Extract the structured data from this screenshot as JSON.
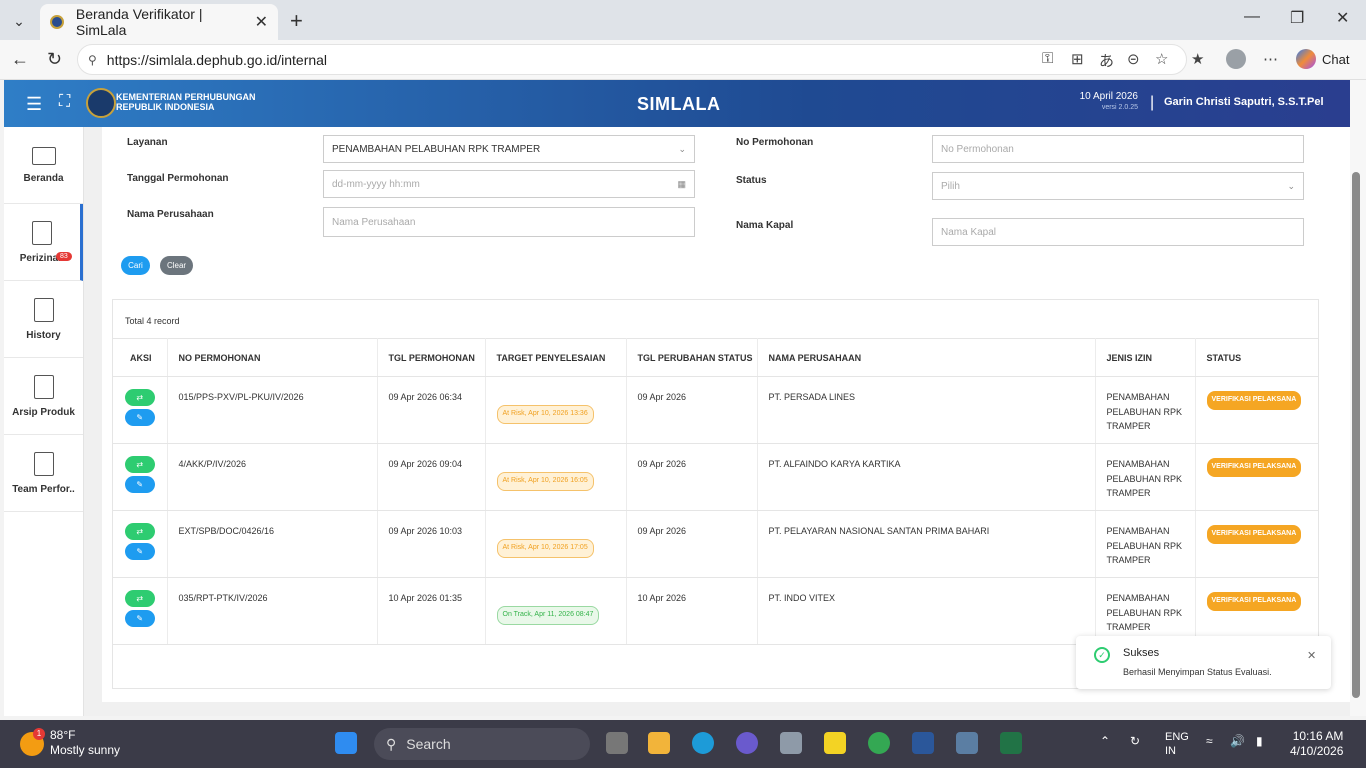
{
  "browser": {
    "tab_title": "Beranda Verifikator | SimLala",
    "url": "https://simlala.dephub.go.id/internal",
    "chat_label": "Chat"
  },
  "header": {
    "org_line1": "KEMENTERIAN PERHUBUNGAN",
    "org_line2": "REPUBLIK INDONESIA",
    "app_title": "SIMLALA",
    "date": "10 April 2026",
    "version": "versi 2.0.25",
    "user": "Garin Christi Saputri, S.S.T.Pel"
  },
  "sidebar": {
    "items": [
      {
        "label": "Beranda",
        "icon": "monitor-icon"
      },
      {
        "label": "Perizinan",
        "icon": "document-icon",
        "badge": "83"
      },
      {
        "label": "History",
        "icon": "document-icon"
      },
      {
        "label": "Arsip Produk",
        "icon": "document-icon"
      },
      {
        "label": "Team Perfor..",
        "icon": "document-icon"
      }
    ]
  },
  "filters": {
    "layanan_label": "Layanan",
    "layanan_value": "PENAMBAHAN PELABUHAN RPK TRAMPER",
    "tanggal_label": "Tanggal Permohonan",
    "tanggal_placeholder": "dd-mm-yyyy hh:mm",
    "nama_perusahaan_label": "Nama Perusahaan",
    "nama_perusahaan_placeholder": "Nama Perusahaan",
    "no_permohonan_label": "No Permohonan",
    "no_permohonan_placeholder": "No Permohonan",
    "status_label": "Status",
    "status_placeholder": "Pilih",
    "nama_kapal_label": "Nama Kapal",
    "nama_kapal_placeholder": "Nama Kapal",
    "cari_label": "Cari",
    "clear_label": "Clear"
  },
  "table": {
    "total": "Total 4 record",
    "headers": [
      "AKSI",
      "NO PERMOHONAN",
      "TGL PERMOHONAN",
      "TARGET PENYELESAIAN",
      "TGL PERUBAHAN STATUS",
      "NAMA PERUSAHAAN",
      "JENIS IZIN",
      "STATUS"
    ],
    "rows": [
      {
        "no": "015/PPS-PXV/PL-PKU/IV/2026",
        "tgl": "09 Apr 2026 06:34",
        "target": "At Risk, Apr 10, 2026 13:36",
        "target_kind": "risk",
        "tgl_status": "09 Apr 2026",
        "perusahaan": "PT. PERSADA LINES",
        "jenis": "PENAMBAHAN PELABUHAN RPK TRAMPER",
        "status": "VERIFIKASI PELAKSANA"
      },
      {
        "no": "4/AKK/P/IV/2026",
        "tgl": "09 Apr 2026 09:04",
        "target": "At Risk, Apr 10, 2026 16:05",
        "target_kind": "risk",
        "tgl_status": "09 Apr 2026",
        "perusahaan": "PT. ALFAINDO KARYA KARTIKA",
        "jenis": "PENAMBAHAN PELABUHAN RPK TRAMPER",
        "status": "VERIFIKASI PELAKSANA"
      },
      {
        "no": "EXT/SPB/DOC/0426/16",
        "tgl": "09 Apr 2026 10:03",
        "target": "At Risk, Apr 10, 2026 17:05",
        "target_kind": "risk",
        "tgl_status": "09 Apr 2026",
        "perusahaan": "PT. PELAYARAN NASIONAL SANTAN PRIMA BAHARI",
        "jenis": "PENAMBAHAN PELABUHAN RPK TRAMPER",
        "status": "VERIFIKASI PELAKSANA"
      },
      {
        "no": "035/RPT-PTK/IV/2026",
        "tgl": "10 Apr 2026 01:35",
        "target": "On Track, Apr 11, 2026 08:47",
        "target_kind": "track",
        "tgl_status": "10 Apr 2026",
        "perusahaan": "PT. INDO VITEX",
        "jenis": "PENAMBAHAN PELABUHAN RPK TRAMPER",
        "status": "VERIFIKASI PELAKSANA"
      }
    ]
  },
  "toast": {
    "title": "Sukses",
    "message": "Berhasil Menyimpan Status Evaluasi."
  },
  "taskbar": {
    "weather_badge": "1",
    "temperature": "88°F",
    "condition": "Mostly sunny",
    "search_label": "Search",
    "lang_line1": "ENG",
    "lang_line2": "IN",
    "time": "10:16 AM",
    "date": "4/10/2026"
  },
  "colors": {
    "header_blue": "#2a5ea8",
    "status_orange": "#f5a623",
    "action_green": "#2ecc71",
    "action_blue": "#1e9cf0"
  }
}
